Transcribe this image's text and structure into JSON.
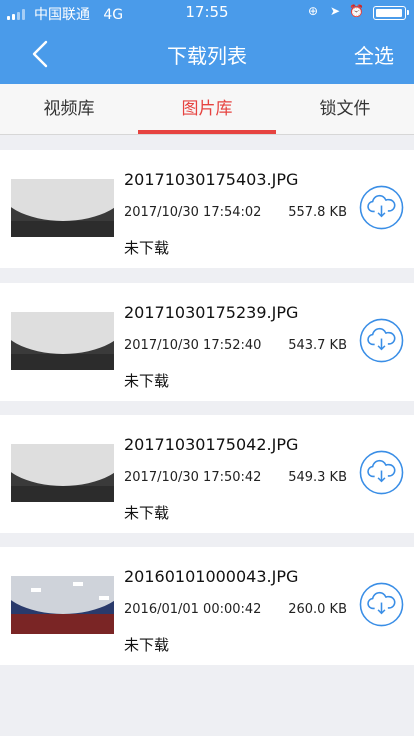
{
  "status_bar": {
    "carrier": "中国联通",
    "network": "4G",
    "time": "17:55"
  },
  "header": {
    "title": "下载列表",
    "select_all": "全选"
  },
  "tabs": [
    {
      "label": "视频库",
      "active": false
    },
    {
      "label": "图片库",
      "active": true
    },
    {
      "label": "锁文件",
      "active": false
    }
  ],
  "files": [
    {
      "name": "20171030175403.JPG",
      "date": "2017/10/30 17:54:02",
      "size": "557.8 KB",
      "status": "未下载"
    },
    {
      "name": "20171030175239.JPG",
      "date": "2017/10/30 17:52:40",
      "size": "543.7 KB",
      "status": "未下载"
    },
    {
      "name": "20171030175042.JPG",
      "date": "2017/10/30 17:50:42",
      "size": "549.3 KB",
      "status": "未下载"
    },
    {
      "name": "20160101000043.JPG",
      "date": "2016/01/01 00:00:42",
      "size": "260.0 KB",
      "status": "未下载"
    }
  ],
  "colors": {
    "header_bg": "#4a9bea",
    "active_tab": "#e64340",
    "icon_blue": "#3a8ee6",
    "page_bg": "#eeeff3"
  },
  "icons": {
    "back": "chevron-left-icon",
    "download": "cloud-download-icon"
  }
}
